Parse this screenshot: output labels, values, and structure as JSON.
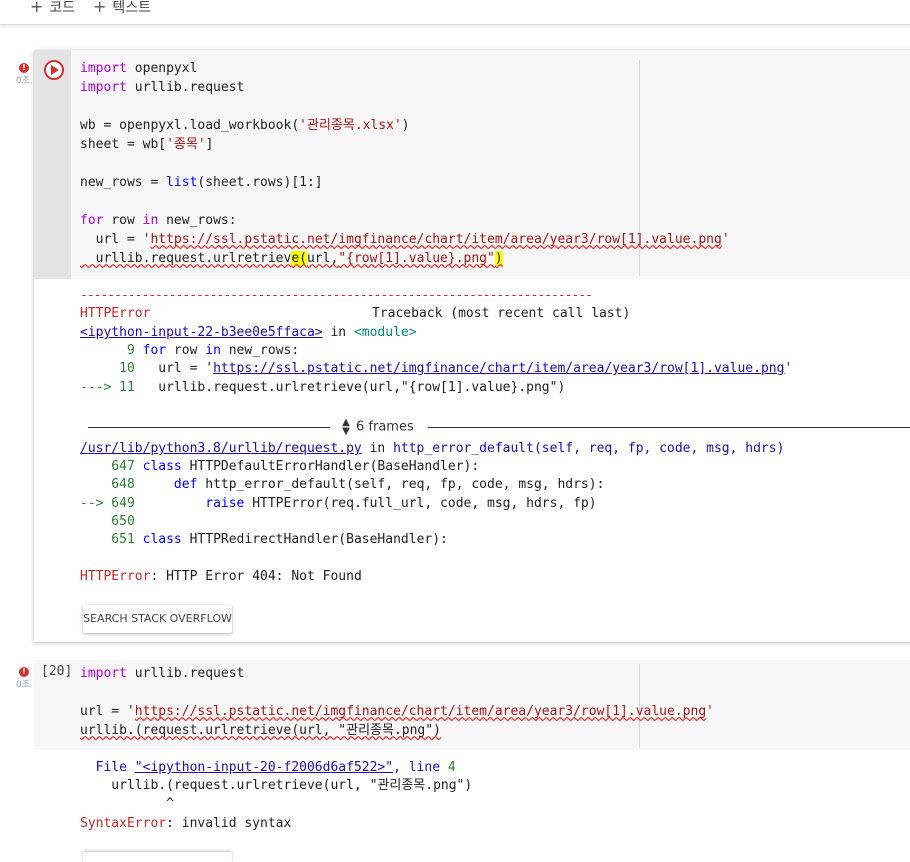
{
  "toolbar": {
    "add_code_plus": "+",
    "add_code_label": "코드",
    "add_text_plus": "+",
    "add_text_label": "텍스트"
  },
  "cell1": {
    "error_mark": "!",
    "elapsed": "0초",
    "code": {
      "l1_kw": "import",
      "l1_rest": " openpyxl",
      "l2_kw": "import",
      "l2_rest": " urllib.request",
      "l4_a": "wb = openpyxl.load_workbook(",
      "l4_str": "'관리종목.xlsx'",
      "l4_b": ")",
      "l5_a": "sheet = wb[",
      "l5_str": "'종목'",
      "l5_b": "]",
      "l7_a": "new_rows = ",
      "l7_fn": "list",
      "l7_b": "(sheet.rows)[1:]",
      "l9_kw": "for",
      "l9_a": " row ",
      "l9_kw2": "in",
      "l9_b": " new_rows:",
      "l10_a": "  url = '",
      "l10_url": "https://ssl.pstatic.net/imgfinance/chart/item/area/year3/row[1].value.png",
      "l10_b": "'",
      "l11_a": "  urllib.request.urlretriev",
      "l11_hl1": "e(",
      "l11_b": "url,",
      "l11_str": "\"{row[1].value}.png\"",
      "l11_hl2": ")"
    },
    "output": {
      "dashes": "---------------------------------------------------------------------------",
      "err_name": "HTTPError",
      "traceback_hdr": "Traceback (most recent call last)",
      "input_link": "<ipython-input-22-b3ee0e5ffaca>",
      "in_word": " in ",
      "module": "<module>",
      "t9_num": "      9 ",
      "t9_kw": "for",
      "t9_a": " row ",
      "t9_kw2": "in",
      "t9_b": " new_rows:",
      "t10_num": "     10 ",
      "t10_a": "  url = '",
      "t10_url": "https://ssl.pstatic.net/imgfinance/chart/item/area/year3/row[1].value.png",
      "t10_b": "'",
      "t11_arrow": "---> 11 ",
      "t11_a": "  urllib.request.urlretrieve(url,\"{row[1].value}.png\")",
      "frames_label": "6 frames",
      "path_link": "/usr/lib/python3.8/urllib/request.py",
      "path_in": " in ",
      "func_sig": "http_error_default(self, req, fp, code, msg, hdrs)",
      "f647_num": "    647 ",
      "f647_kw": "class",
      "f647_b": " HTTPDefaultErrorHandler(BaseHandler):",
      "f648_num": "    648 ",
      "f648_kw": "    def",
      "f648_b": " http_error_default(self, req, fp, code, msg, hdrs):",
      "f649_arrow": "--> 649 ",
      "f649_kw": "        raise",
      "f649_b": " HTTPError(req.full_url, code, msg, hdrs, fp)",
      "f650_num": "    650 ",
      "f651_num": "    651 ",
      "f651_kw": "class",
      "f651_b": " HTTPRedirectHandler(BaseHandler):",
      "final_err": "HTTPError",
      "final_msg": ": HTTP Error 404: Not Found"
    },
    "search_so": "SEARCH STACK OVERFLOW"
  },
  "cell2": {
    "error_mark": "!",
    "elapsed": "0초",
    "exec_count": "[20]",
    "code": {
      "l1_kw": "import",
      "l1_rest": " urllib.request",
      "l3_a": "url = '",
      "l3_url": "https://ssl.pstatic.net/imgfinance/chart/item/area/year3/row[1].value.png",
      "l3_b": "'",
      "l4": "urllib.(request.urlretrieve(url, \"관리종목.png\")"
    },
    "output": {
      "file_word": "  File ",
      "file_link": "\"<ipython-input-20-f2006d6af522>\"",
      "line_word": ", line ",
      "line_num": "4",
      "src_line": "    urllib.(request.urlretrieve(url, \"관리종목.png\")",
      "caret": "           ^",
      "err_name": "SyntaxError",
      "err_msg": ": invalid syntax"
    }
  }
}
